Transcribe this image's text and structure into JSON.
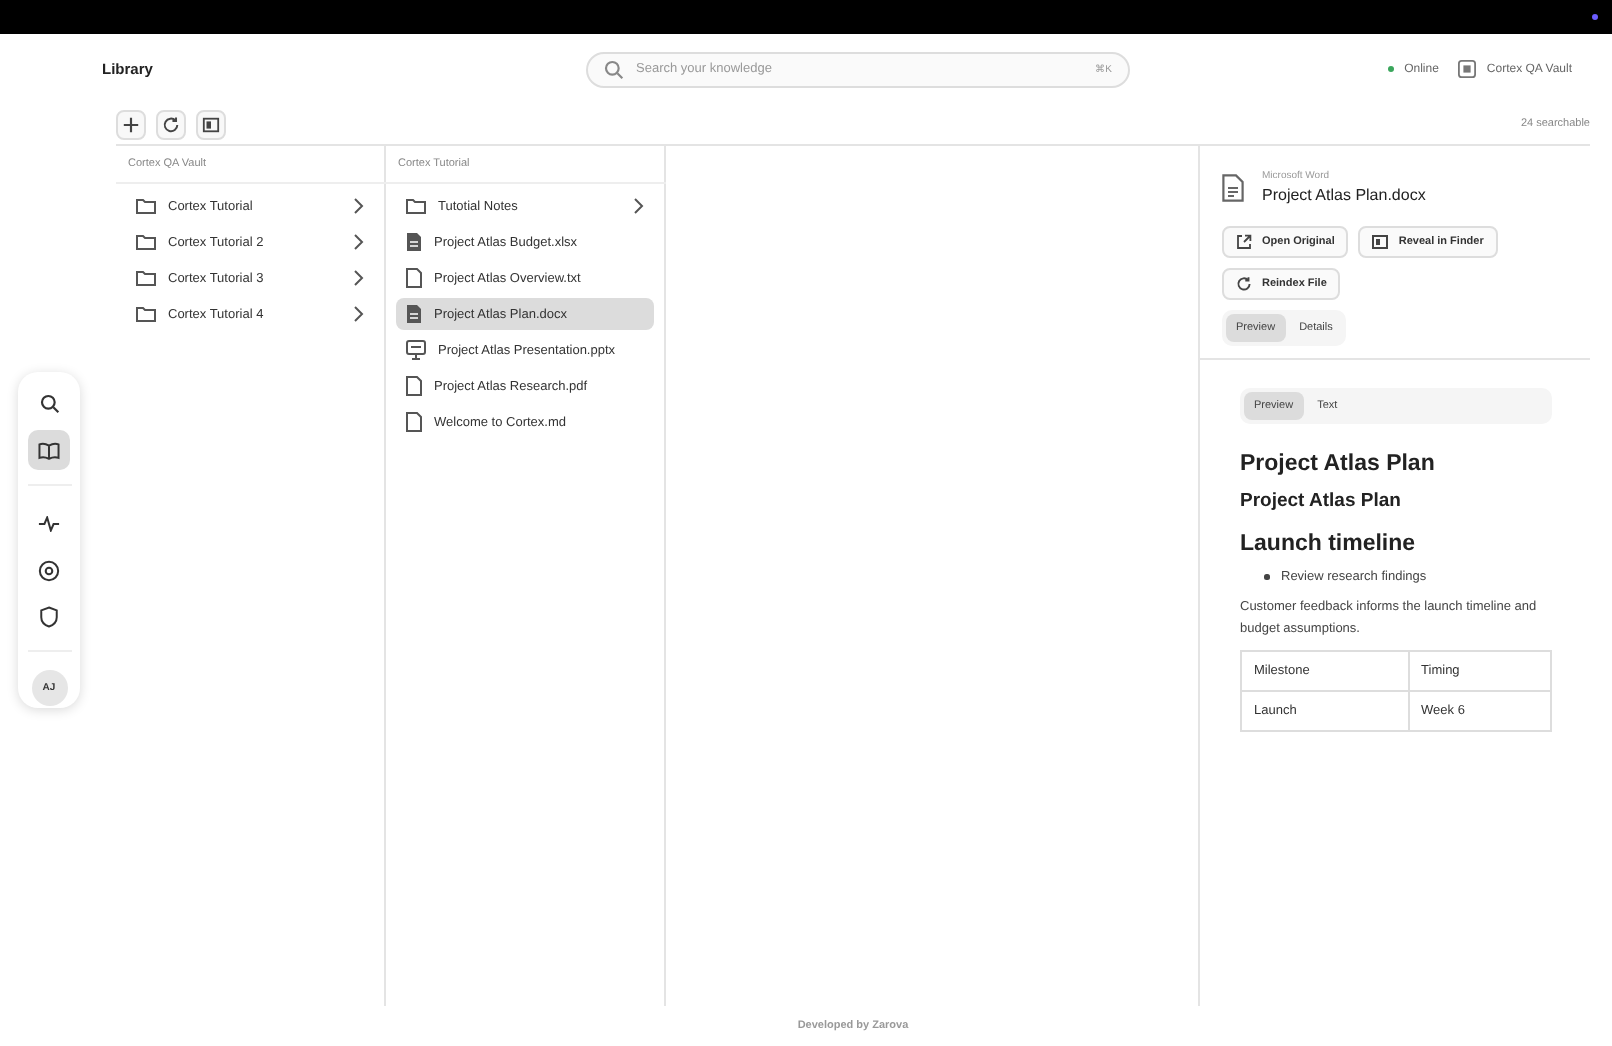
{
  "header": {
    "title": "Library",
    "search": {
      "placeholder": "Search your knowledge",
      "shortcut": "⌘K"
    },
    "status": "Online",
    "vault": "Cortex QA Vault"
  },
  "toolbar": {
    "buttons": [
      {
        "kind": "add"
      },
      {
        "kind": "refresh"
      },
      {
        "kind": "panel"
      }
    ],
    "count": "24 searchable"
  },
  "columns": [
    {
      "title": "Cortex QA Vault",
      "items": [
        {
          "label": "Cortex Tutorial",
          "kind": "folder",
          "selected": false
        },
        {
          "label": "Cortex Tutorial 2",
          "kind": "folder",
          "selected": false
        },
        {
          "label": "Cortex Tutorial 3",
          "kind": "folder",
          "selected": false
        },
        {
          "label": "Cortex Tutorial 4",
          "kind": "folder",
          "selected": false
        }
      ]
    },
    {
      "title": "Cortex Tutorial",
      "items": [
        {
          "label": "Tutotial Notes",
          "kind": "folder",
          "selected": false
        },
        {
          "label": "Project Atlas Budget.xlsx",
          "kind": "sheet",
          "selected": false
        },
        {
          "label": "Project Atlas Overview.txt",
          "kind": "file",
          "selected": false
        },
        {
          "label": "Project Atlas Plan.docx",
          "kind": "sheet",
          "selected": true
        },
        {
          "label": "Project Atlas Presentation.pptx",
          "kind": "slides",
          "selected": false
        },
        {
          "label": "Project Atlas Research.pdf",
          "kind": "file",
          "selected": false
        },
        {
          "label": "Welcome to Cortex.md",
          "kind": "file",
          "selected": false
        }
      ]
    }
  ],
  "detail": {
    "type": "Microsoft Word",
    "name": "Project Atlas Plan.docx",
    "actions": [
      {
        "label": "Open Original",
        "kind": "open"
      },
      {
        "label": "Reveal in Finder",
        "kind": "reveal"
      },
      {
        "label": "Reindex File",
        "kind": "refresh"
      }
    ],
    "tabs": [
      {
        "label": "Preview",
        "selected": true
      },
      {
        "label": "Details",
        "selected": false
      }
    ],
    "preview": {
      "tabs": [
        {
          "label": "Preview",
          "selected": true
        },
        {
          "label": "Text",
          "selected": false
        }
      ],
      "blocks": [
        {
          "kind": "h1",
          "text": "Project Atlas Plan"
        },
        {
          "kind": "h2",
          "text": "Project Atlas Plan"
        },
        {
          "kind": "h1",
          "text": "Launch timeline"
        },
        {
          "kind": "list",
          "items": [
            "Review research findings"
          ]
        },
        {
          "kind": "p",
          "text": "Customer feedback informs the launch timeline and budget assumptions."
        },
        {
          "kind": "table",
          "rows": [
            [
              "Milestone",
              "Timing"
            ],
            [
              "Launch",
              "Week 6"
            ]
          ]
        }
      ]
    }
  },
  "rail": {
    "items": [
      {
        "kind": "search",
        "selected": false
      },
      {
        "kind": "library",
        "selected": true
      },
      {
        "kind": "divider"
      },
      {
        "kind": "activity",
        "selected": false
      },
      {
        "kind": "settings",
        "selected": false
      },
      {
        "kind": "shield",
        "selected": false
      },
      {
        "kind": "divider"
      }
    ],
    "avatar": "AJ"
  },
  "footer": "Developed by Zarova"
}
